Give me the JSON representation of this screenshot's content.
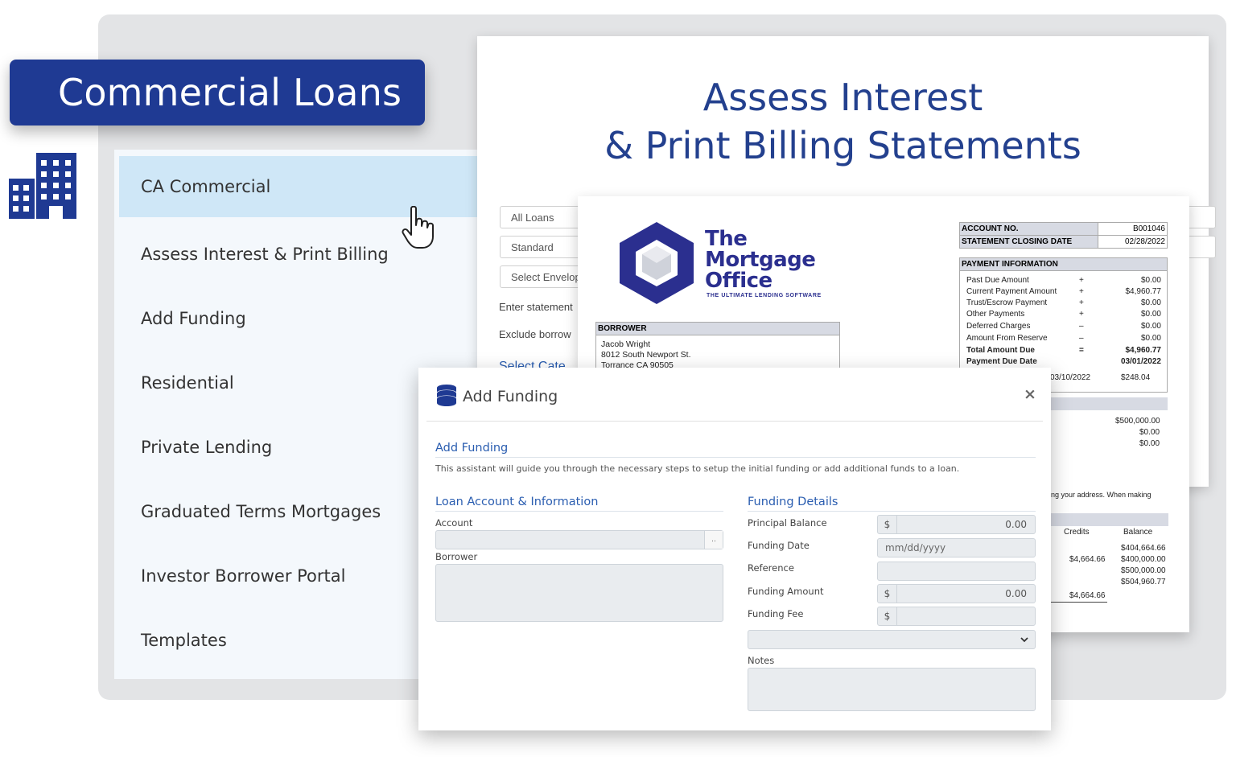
{
  "banner": {
    "title": "Commercial Loans"
  },
  "menu": {
    "items": [
      {
        "label": "CA Commercial",
        "active": true
      },
      {
        "label": "Assess Interest & Print Billing"
      },
      {
        "label": "Add Funding"
      },
      {
        "label": "Residential"
      },
      {
        "label": "Private Lending"
      },
      {
        "label": "Graduated Terms Mortgages"
      },
      {
        "label": "Investor Borrower Portal"
      },
      {
        "label": "Templates"
      }
    ]
  },
  "assess": {
    "title_line1": "Assess Interest",
    "title_line2": "& Print Billing Statements",
    "loan_filter": "All Loans",
    "type_select": "Standard",
    "envelope_select": "Select Envelope",
    "enter_statement_label": "Enter statement",
    "exclude_borrower_label": "Exclude borrow",
    "select_link": "Select Cate"
  },
  "statement": {
    "logo_lines": [
      "The",
      "Mortgage",
      "Office"
    ],
    "logo_tagline": "THE ULTIMATE LENDING SOFTWARE",
    "account_no_label": "ACCOUNT NO.",
    "account_no": "B001046",
    "closing_date_label": "STATEMENT CLOSING DATE",
    "closing_date": "02/28/2022",
    "payment_info_label": "PAYMENT INFORMATION",
    "payment_rows": [
      {
        "name": "Past Due Amount",
        "sign": "+",
        "amount": "$0.00"
      },
      {
        "name": "Current Payment Amount",
        "sign": "+",
        "amount": "$4,960.77"
      },
      {
        "name": "Trust/Escrow Payment",
        "sign": "+",
        "amount": "$0.00"
      },
      {
        "name": "Other Payments",
        "sign": "+",
        "amount": "$0.00"
      },
      {
        "name": "Deferred Charges",
        "sign": "–",
        "amount": "$0.00"
      },
      {
        "name": "Amount From Reserve",
        "sign": "–",
        "amount": "$0.00"
      },
      {
        "name": "Total Amount Due",
        "sign": "=",
        "amount": "$4,960.77",
        "bold": true
      },
      {
        "name": "Payment Due Date",
        "sign": "",
        "amount": "03/01/2022",
        "bold": true
      }
    ],
    "partial_date": "03/10/2022",
    "partial_amount": "$248.04",
    "balances": [
      "$500,000.00",
      "$0.00",
      "$0.00"
    ],
    "address_note": "ng your address. When making",
    "credits_header": "Credits",
    "balance_header": "Balance",
    "credit_values": [
      "$4,664.66",
      "$4,664.66"
    ],
    "balance_values": [
      "$404,664.66",
      "$400,000.00",
      "$500,000.00",
      "$504,960.77"
    ],
    "borrower_label": "BORROWER",
    "borrower_name": "Jacob Wright",
    "borrower_address1": "8012 South Newport St.",
    "borrower_address2": "Torrance CA 90505"
  },
  "modal": {
    "title": "Add Funding",
    "close": "×",
    "section_title": "Add Funding",
    "description": "This assistant will guide you through the necessary steps to setup the initial funding or add additional funds to a loan.",
    "left_section": "Loan Account & Information",
    "account_label": "Account",
    "account_lookup": "..",
    "borrower_label": "Borrower",
    "right_section": "Funding Details",
    "principal_label": "Principal Balance",
    "principal_value": "0.00",
    "currency": "$",
    "funding_date_label": "Funding Date",
    "funding_date_placeholder": "mm/dd/yyyy",
    "reference_label": "Reference",
    "funding_amount_label": "Funding Amount",
    "funding_amount_value": "0.00",
    "funding_fee_label": "Funding Fee",
    "notes_label": "Notes"
  },
  "colors": {
    "brand": "#1f3a93",
    "accent_blue": "#2a5db0",
    "menu_active": "#cfe7f7"
  }
}
